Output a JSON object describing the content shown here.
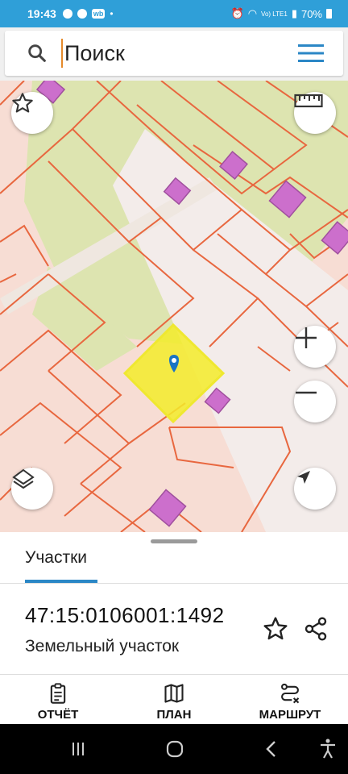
{
  "status_bar": {
    "time": "19:43",
    "wb_label": "wb",
    "network": "Vo) LTE1",
    "battery": "70%"
  },
  "search": {
    "placeholder": "Поиск"
  },
  "map": {
    "parcel_fill": "#f3ec2a",
    "building_fill": "#cc6fcc",
    "boundary_color": "#e8673f",
    "land_fill": "#dde4b0"
  },
  "sheet": {
    "tab_label": "Участки",
    "parcel_id": "47:15:0106001:1492",
    "parcel_type": "Земельный участок"
  },
  "actions": {
    "report_label": "ОТЧЁТ",
    "plan_label": "ПЛАН",
    "route_label": "МАРШРУТ"
  },
  "colors": {
    "accent": "#2b87c6",
    "status_bar": "#2f9fd8"
  }
}
